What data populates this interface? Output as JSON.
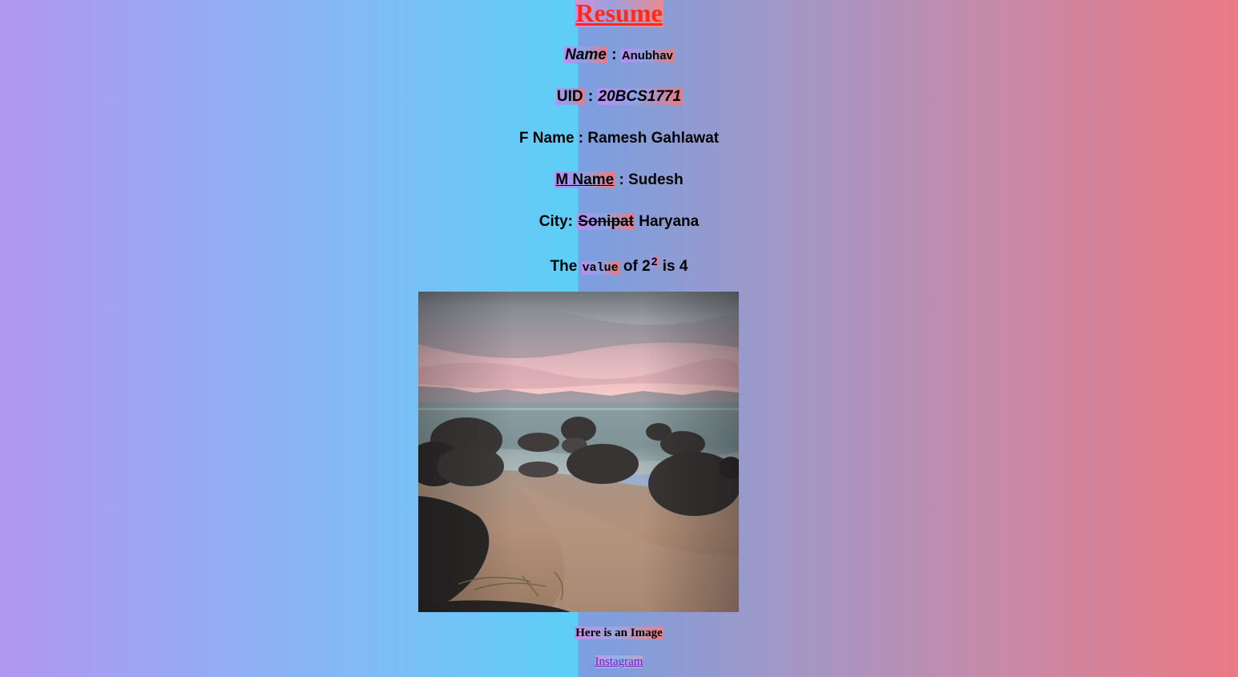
{
  "title": "Resume",
  "name": {
    "label": "Name",
    "sep": " : ",
    "value": "Anubhav"
  },
  "uid": {
    "label": "UID",
    "sep": " : ",
    "value": "20BCS1771"
  },
  "fname": {
    "label": "F Name",
    "sep": " : ",
    "value": "Ramesh Gahlawat"
  },
  "mname": {
    "label": "M Name",
    "sep": " : ",
    "value": "Sudesh"
  },
  "city": {
    "label": "City:",
    "struck": "Sonipat",
    "value": "Haryana"
  },
  "math": {
    "prefix": "The",
    "code": "value",
    "mid": "of 2",
    "exp": "2",
    "suffix": "is 4"
  },
  "image": {
    "caption": "Here is an Image",
    "icon": "beach-rocks-sunset-photo"
  },
  "link": {
    "label": "Instagram"
  },
  "colors": {
    "title": "#ff2a1a",
    "link": "#6f1fc9"
  }
}
